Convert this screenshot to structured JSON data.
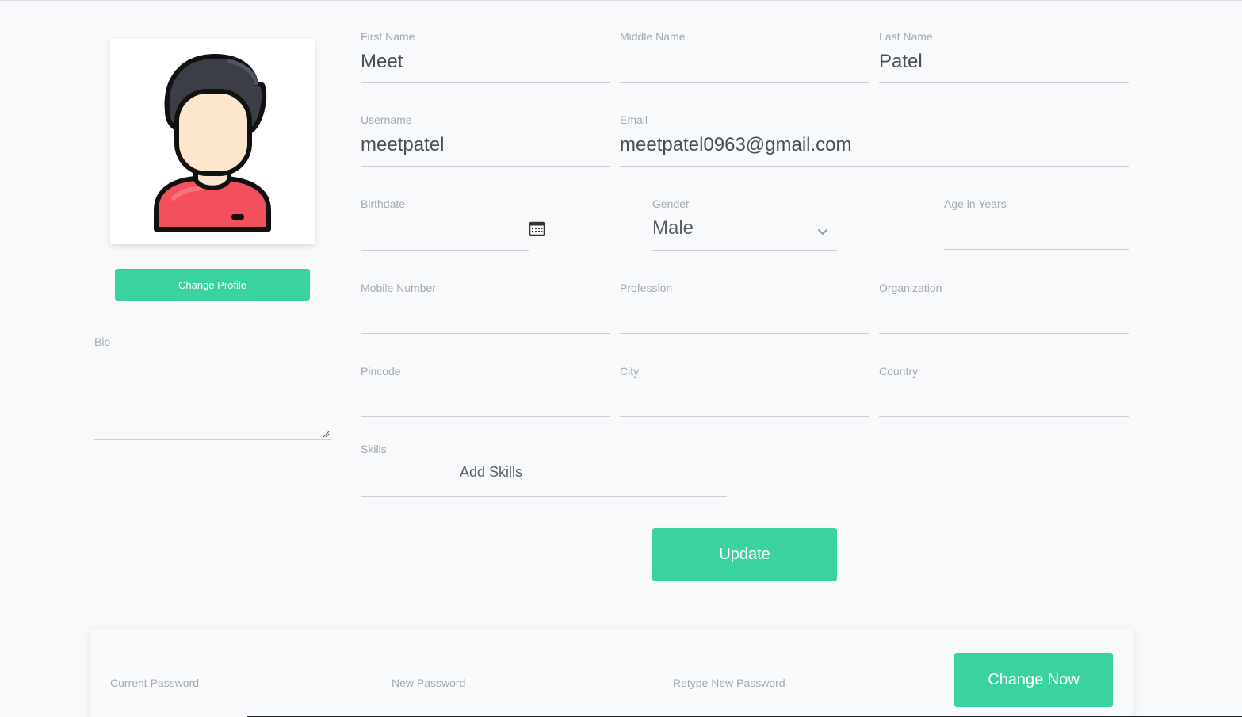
{
  "profile": {
    "change_profile_label": "Change Profile",
    "bio_label": "Bio"
  },
  "fields": {
    "first_name": {
      "label": "First Name",
      "value": "Meet"
    },
    "middle_name": {
      "label": "Middle Name",
      "value": ""
    },
    "last_name": {
      "label": "Last Name",
      "value": "Patel"
    },
    "username": {
      "label": "Username",
      "value": "meetpatel"
    },
    "email": {
      "label": "Email",
      "value": "meetpatel0963@gmail.com"
    },
    "birthdate": {
      "label": "Birthdate",
      "value": ""
    },
    "gender": {
      "label": "Gender",
      "value": "Male"
    },
    "age": {
      "label": "Age in Years",
      "value": ""
    },
    "mobile": {
      "label": "Mobile Number",
      "value": ""
    },
    "profession": {
      "label": "Profession",
      "value": ""
    },
    "organization": {
      "label": "Organization",
      "value": ""
    },
    "pincode": {
      "label": "Pincode",
      "value": ""
    },
    "city": {
      "label": "City",
      "value": ""
    },
    "country": {
      "label": "Country",
      "value": ""
    },
    "skills": {
      "label": "Skills",
      "placeholder": "Add Skills"
    }
  },
  "actions": {
    "update_label": "Update"
  },
  "password": {
    "current_label": "Current Password",
    "new_label": "New Password",
    "retype_label": "Retype New Password",
    "change_label": "Change Now"
  },
  "icons": {
    "calendar": "calendar-icon",
    "chevron": "chevron-down-icon",
    "avatar": "user-avatar"
  },
  "colors": {
    "accent": "#3ad29f",
    "avatar_shirt": "#f2505d",
    "avatar_hair": "#3b3d47",
    "avatar_skin": "#fde6ce"
  }
}
